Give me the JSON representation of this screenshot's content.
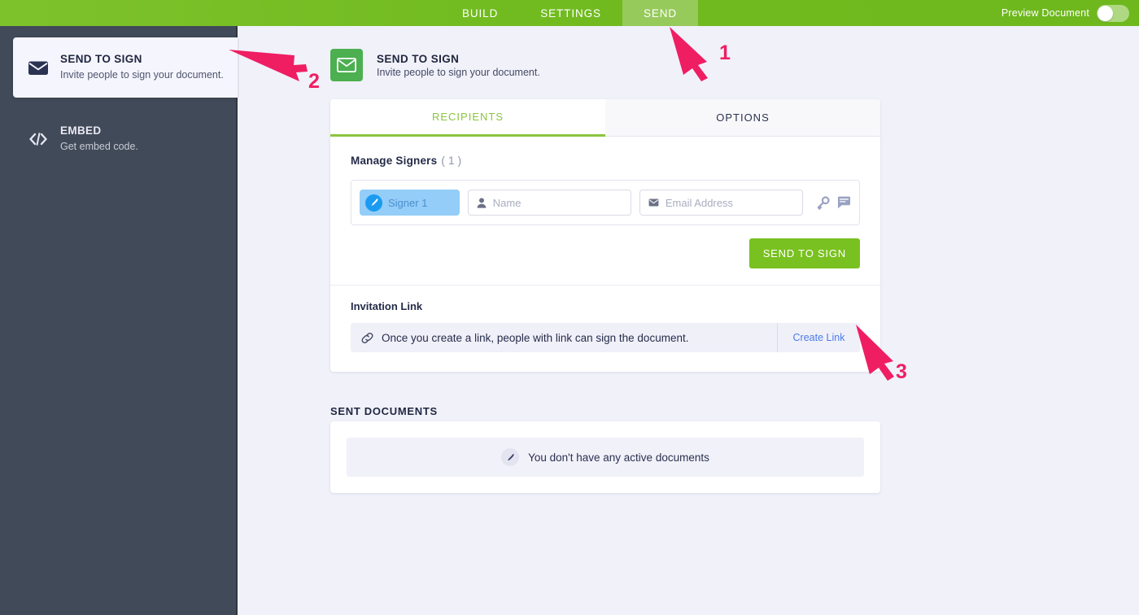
{
  "topbar": {
    "tabs": [
      {
        "label": "BUILD",
        "active": false
      },
      {
        "label": "SETTINGS",
        "active": false
      },
      {
        "label": "SEND",
        "active": true
      }
    ],
    "preview_label": "Preview Document",
    "toggle_state": "off",
    "active_tab_bg": "#96ca5b",
    "bar_color": "#74bd22"
  },
  "sidebar": {
    "items": [
      {
        "title": "SEND TO SIGN",
        "subtitle": "Invite people to sign your document.",
        "icon": "envelope-icon",
        "active": true
      },
      {
        "title": "EMBED",
        "subtitle": "Get embed code.",
        "icon": "code-icon",
        "active": false
      }
    ],
    "bg_color": "#414a59"
  },
  "main": {
    "doc_header": {
      "title": "SEND TO SIGN",
      "subtitle": "Invite people to sign your document.",
      "icon": "envelope-icon",
      "icon_bg": "#4caf50"
    },
    "tabs": [
      {
        "label": "RECIPIENTS",
        "active": true
      },
      {
        "label": "OPTIONS",
        "active": false
      }
    ],
    "accent_color": "#8bc53f",
    "recipients": {
      "panel_title": "Manage Signers",
      "count": "( 1 )",
      "signer_chip": "Signer 1",
      "name_placeholder": "Name",
      "name_value": "",
      "email_placeholder": "Email Address",
      "email_value": "",
      "row_icons": [
        "key-icon",
        "comment-icon"
      ],
      "send_button": "SEND TO SIGN"
    },
    "invitation": {
      "title": "Invitation Link",
      "text": "Once you create a link, people with link can sign the document.",
      "icon": "link-icon",
      "action_label": "Create Link",
      "action_color": "#4a7ce8"
    },
    "sent_documents": {
      "title": "SENT DOCUMENTS",
      "empty_text": "You don't have any active documents",
      "empty_icon": "pen-icon"
    }
  },
  "annotations": [
    {
      "number": "1",
      "target": "send-tab"
    },
    {
      "number": "2",
      "target": "sidebar-send-to-sign"
    },
    {
      "number": "3",
      "target": "create-link-button"
    }
  ],
  "colors": {
    "annotation": "#ef1e63",
    "page_bg": "#f1f1fa"
  }
}
